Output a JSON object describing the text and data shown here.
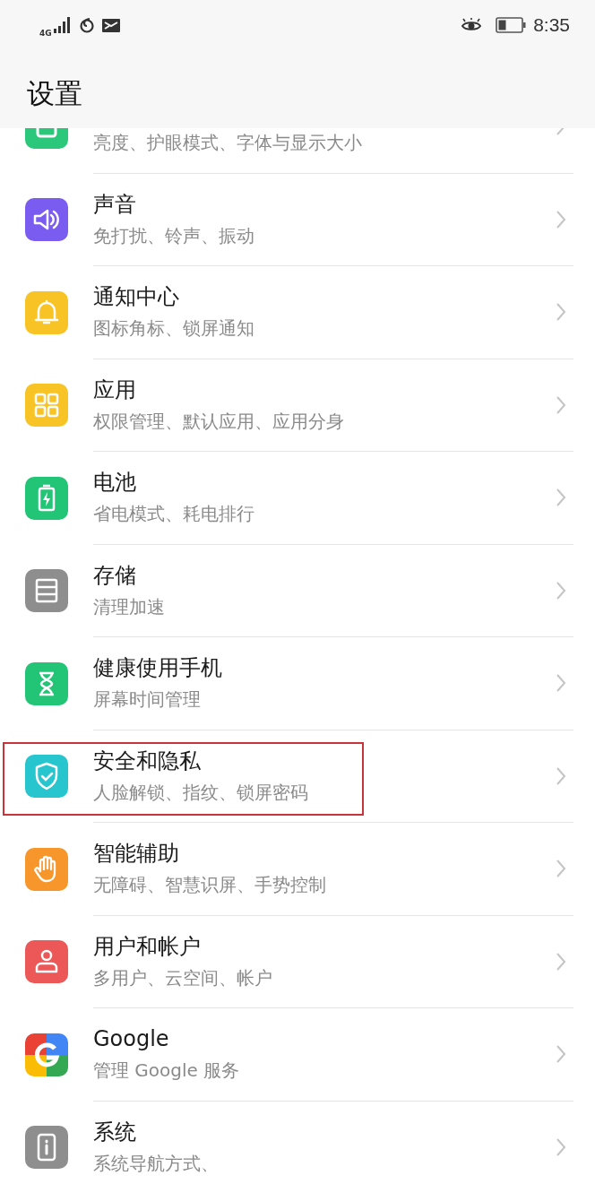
{
  "status_bar": {
    "network": "4G",
    "time": "8:35"
  },
  "header": {
    "title": "设置"
  },
  "items": [
    {
      "kind": "display",
      "color": "#2bc77a",
      "subtitle": "亮度、护眼模式、字体与显示大小",
      "highlighted": false
    },
    {
      "kind": "sound",
      "color": "#7b5cf0",
      "title": "声音",
      "subtitle": "免打扰、铃声、振动",
      "highlighted": false
    },
    {
      "kind": "bell",
      "color": "#f7c325",
      "title": "通知中心",
      "subtitle": "图标角标、锁屏通知",
      "highlighted": false
    },
    {
      "kind": "apps",
      "color": "#f7c325",
      "title": "应用",
      "subtitle": "权限管理、默认应用、应用分身",
      "highlighted": false
    },
    {
      "kind": "battery",
      "color": "#22c475",
      "title": "电池",
      "subtitle": "省电模式、耗电排行",
      "highlighted": false
    },
    {
      "kind": "storage",
      "color": "#8e8e8e",
      "title": "存储",
      "subtitle": "清理加速",
      "highlighted": false
    },
    {
      "kind": "hourglass",
      "color": "#22c475",
      "title": "健康使用手机",
      "subtitle": "屏幕时间管理",
      "highlighted": false
    },
    {
      "kind": "shield",
      "color": "#27c6cf",
      "title": "安全和隐私",
      "subtitle": "人脸解锁、指纹、锁屏密码",
      "highlighted": true
    },
    {
      "kind": "hand",
      "color": "#f7962b",
      "title": "智能辅助",
      "subtitle": "无障碍、智慧识屏、手势控制",
      "highlighted": false
    },
    {
      "kind": "user",
      "color": "#ec5757",
      "title": "用户和帐户",
      "subtitle": "多用户、云空间、帐户",
      "highlighted": false
    },
    {
      "kind": "google",
      "title": "Google",
      "subtitle": "管理 Google 服务",
      "highlighted": false
    },
    {
      "kind": "system",
      "color": "#8e8e8e",
      "title": "系统",
      "subtitle": "系统导航方式、",
      "highlighted": false
    }
  ]
}
